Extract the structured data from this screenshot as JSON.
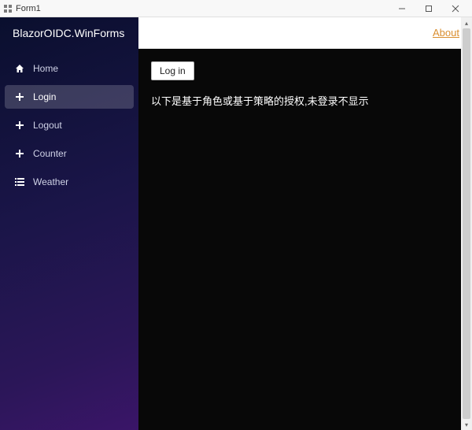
{
  "window": {
    "title": "Form1"
  },
  "brand": {
    "label": "BlazorOIDC.WinForms"
  },
  "topbar": {
    "about": "About"
  },
  "nav": {
    "items": [
      {
        "label": "Home"
      },
      {
        "label": "Login"
      },
      {
        "label": "Logout"
      },
      {
        "label": "Counter"
      },
      {
        "label": "Weather"
      }
    ]
  },
  "content": {
    "login_button": "Log in",
    "auth_note": "以下是基于角色或基于策略的授权,未登录不显示"
  }
}
